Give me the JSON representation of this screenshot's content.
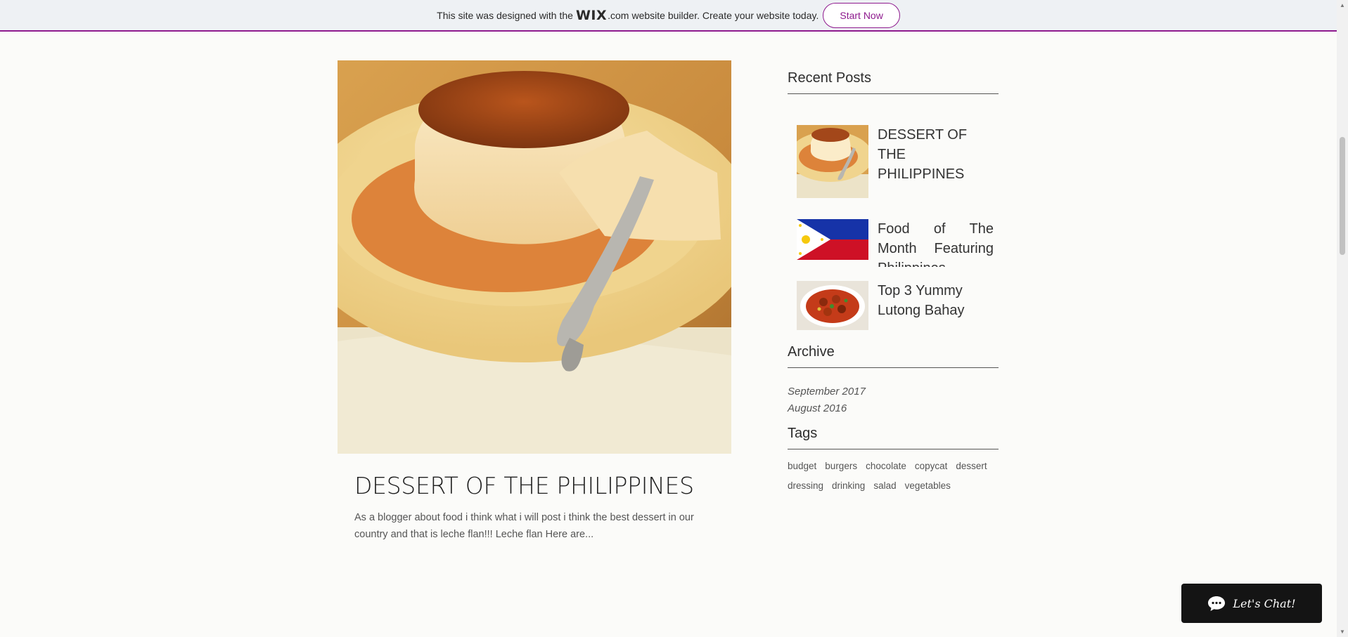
{
  "banner": {
    "text_before": "This site was designed with the",
    "logo": "WIX",
    "logo_suffix": ".com",
    "text_after": "website builder. Create your website today.",
    "button_label": "Start Now",
    "accent_color": "#8e1a8e"
  },
  "post": {
    "title": "DESSERT OF THE PHILIPPINES",
    "excerpt": "As a blogger about food i think what i will post i think the best dessert in our country and that is leche flan!!! Leche flan Here are..."
  },
  "sidebar": {
    "recent_title": "Recent Posts",
    "recent_posts": [
      {
        "title": "DESSERT OF THE PHILIPPINES"
      },
      {
        "title": "Food of The Month Featuring Philippines"
      },
      {
        "title": "Top 3 Yummy Lutong Bahay"
      }
    ],
    "archive_title": "Archive",
    "archive": [
      "September 2017",
      "August 2016"
    ],
    "tags_title": "Tags",
    "tags": [
      "budget",
      "burgers",
      "chocolate",
      "copycat",
      "dessert",
      "dressing",
      "drinking",
      "salad",
      "vegetables"
    ]
  },
  "chat": {
    "label": "Let's Chat!"
  }
}
